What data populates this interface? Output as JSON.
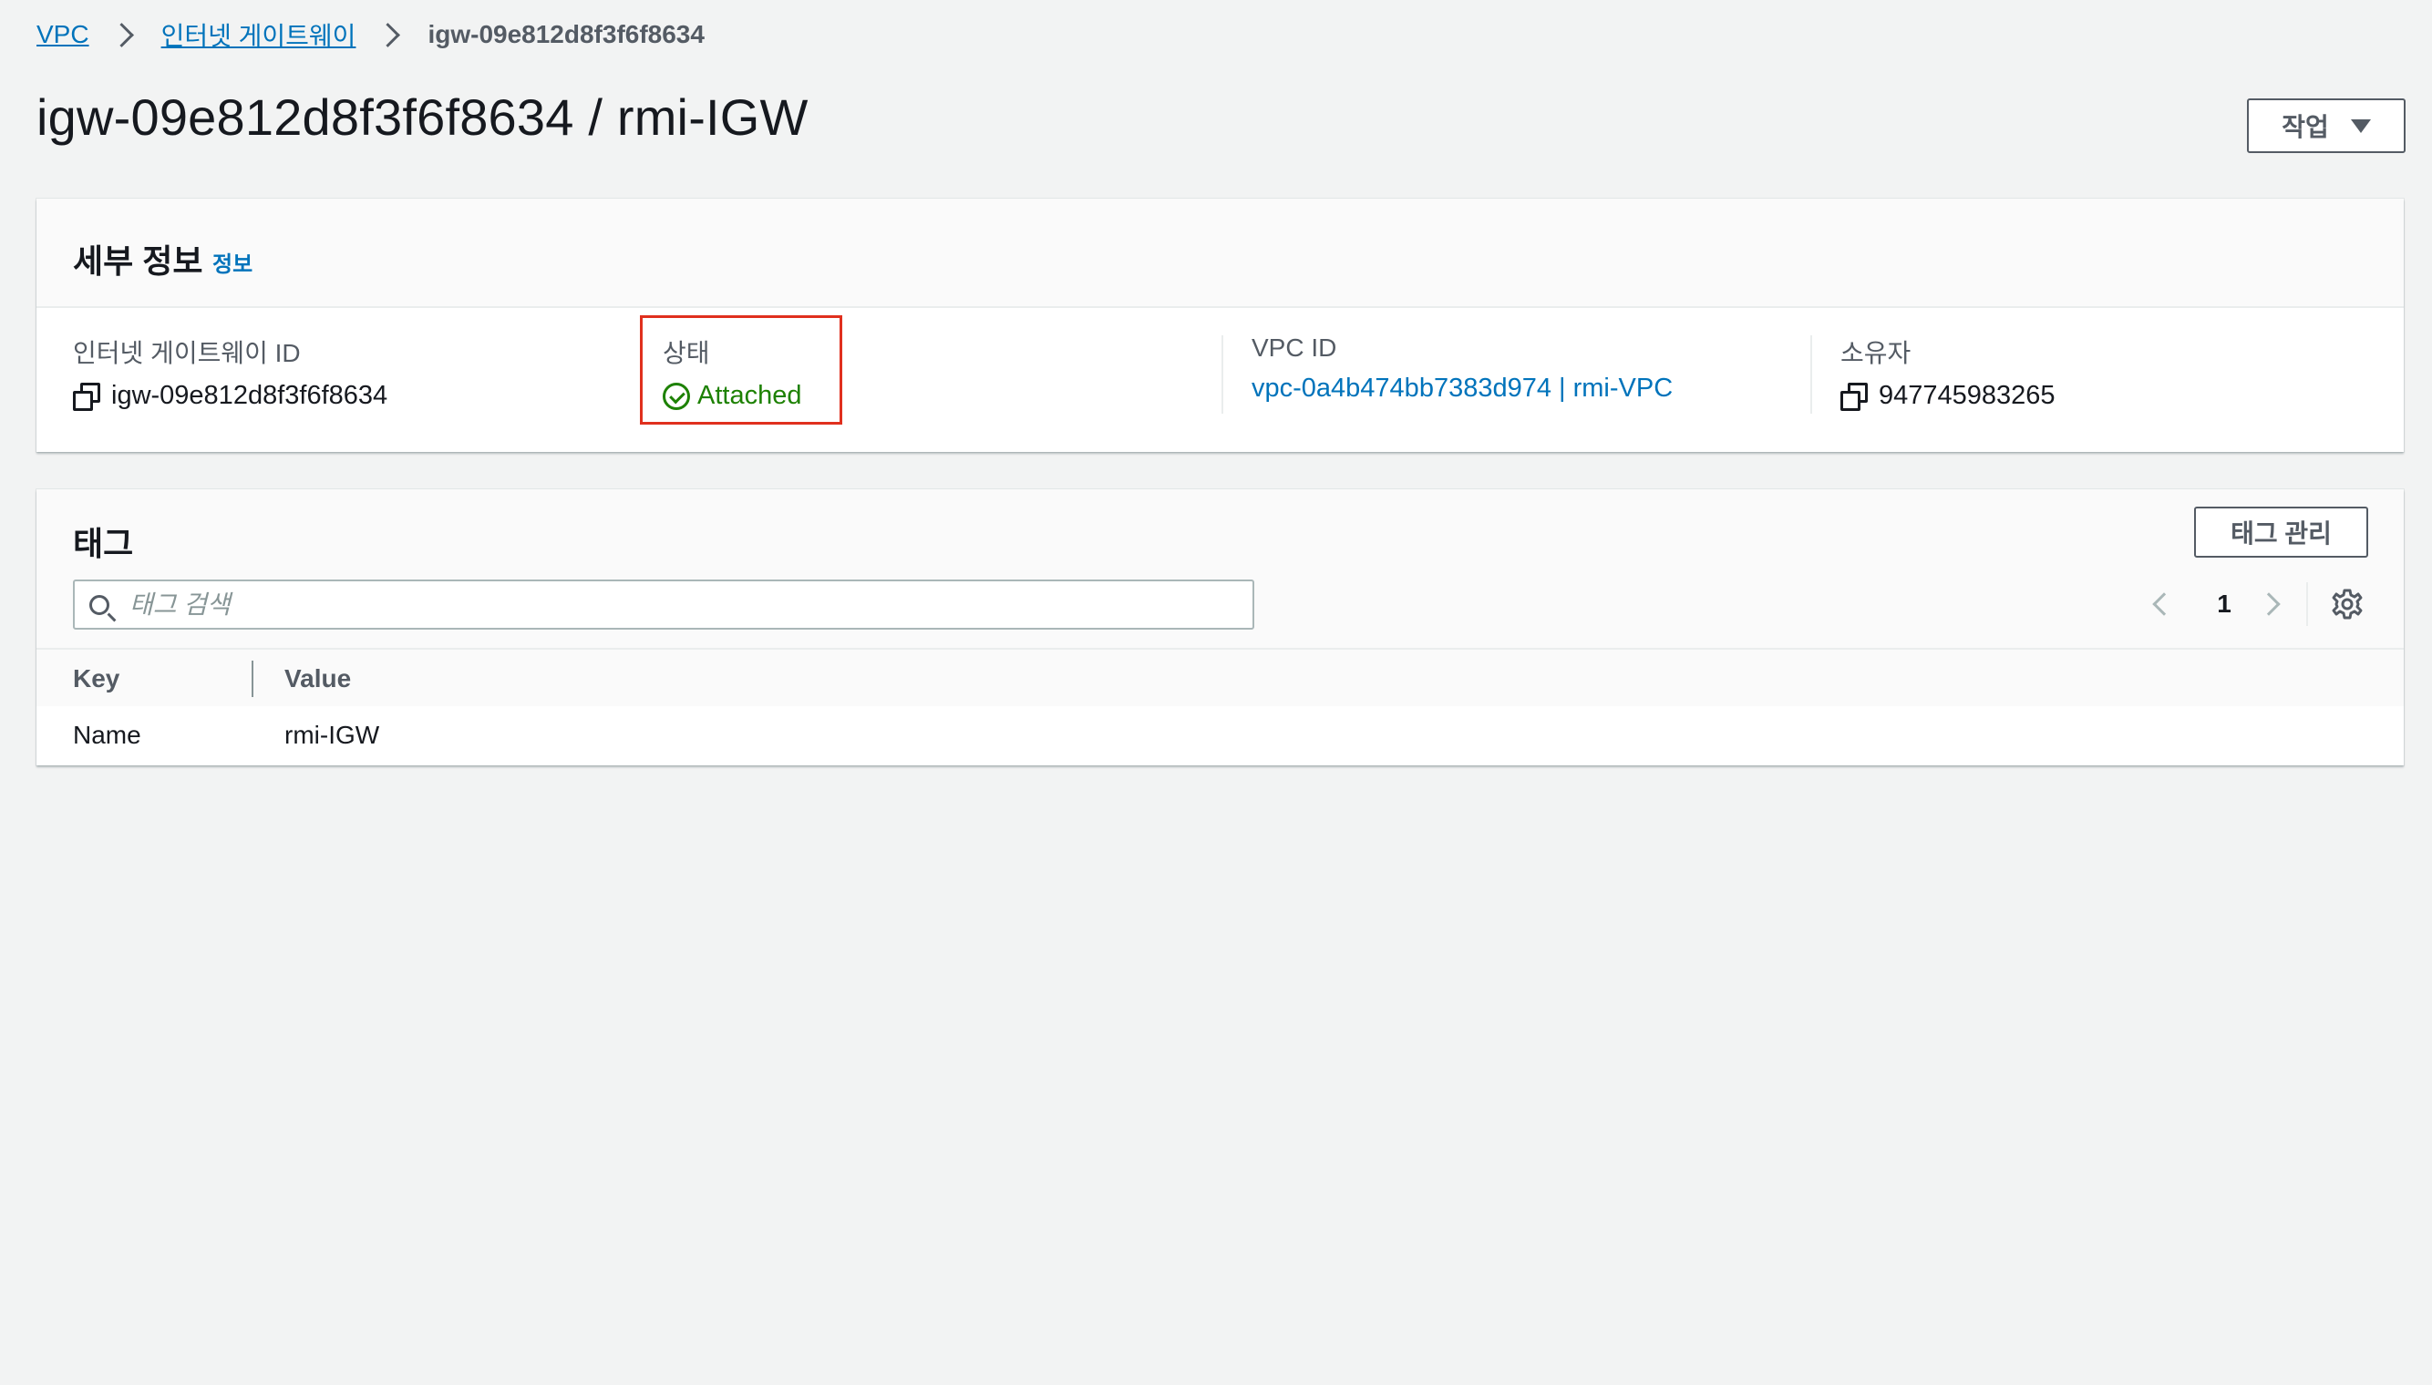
{
  "breadcrumb": {
    "items": [
      {
        "label": "VPC"
      },
      {
        "label": "인터넷 게이트웨이"
      }
    ],
    "current": "igw-09e812d8f3f6f8634"
  },
  "page": {
    "title": "igw-09e812d8f3f6f8634 / rmi-IGW",
    "actions_label": "작업"
  },
  "details": {
    "title": "세부 정보",
    "info_link": "정보",
    "igw_id_label": "인터넷 게이트웨이 ID",
    "igw_id_value": "igw-09e812d8f3f6f8634",
    "state_label": "상태",
    "state_value": "Attached",
    "vpc_id_label": "VPC ID",
    "vpc_id_value": "vpc-0a4b474bb7383d974 | rmi-VPC",
    "owner_label": "소유자",
    "owner_value": "947745983265"
  },
  "tags": {
    "title": "태그",
    "manage_label": "태그 관리",
    "search_placeholder": "태그 검색",
    "page_number": "1",
    "columns": [
      "Key",
      "Value"
    ],
    "rows": [
      {
        "key": "Name",
        "value": "rmi-IGW"
      }
    ]
  },
  "colors": {
    "link": "#0073bb",
    "status_ok": "#1d8102",
    "highlight": "#e0301e"
  }
}
